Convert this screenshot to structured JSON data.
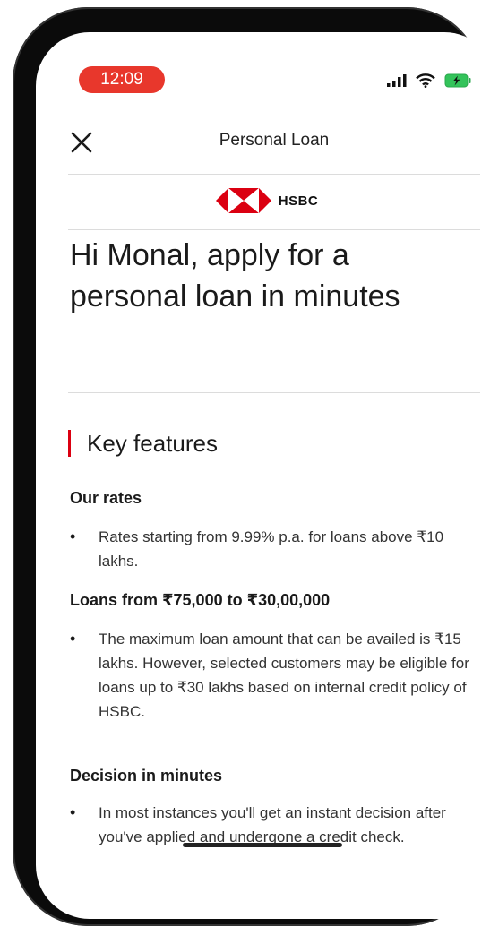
{
  "status_bar": {
    "time": "12:09",
    "time_pill_color": "#e8372c",
    "signal_icon": "cellular-signal-icon",
    "wifi_icon": "wifi-icon",
    "battery_icon": "battery-charging-icon"
  },
  "header": {
    "title": "Personal Loan",
    "close_icon": "close-icon"
  },
  "brand": {
    "name": "HSBC",
    "logo_icon": "hsbc-hexagon-logo",
    "logo_color": "#db0011"
  },
  "hero": {
    "title": "Hi Monal, apply for a personal loan in minutes"
  },
  "key_features": {
    "title": "Key features",
    "accent_color": "#db0011",
    "sections": [
      {
        "heading": "Our rates",
        "bullets": [
          "Rates starting from 9.99% p.a. for loans above ₹10 lakhs."
        ]
      },
      {
        "heading": "Loans from ₹75,000 to ₹30,00,000",
        "bullets": [
          "The maximum loan amount that can be availed is ₹15 lakhs. However, selected customers may be eligible for loans up to ₹30 lakhs based on internal credit policy of HSBC."
        ]
      },
      {
        "heading": "Decision in minutes",
        "bullets": [
          "In most instances you'll get an instant decision after you've applied and undergone a credit check."
        ]
      }
    ]
  }
}
